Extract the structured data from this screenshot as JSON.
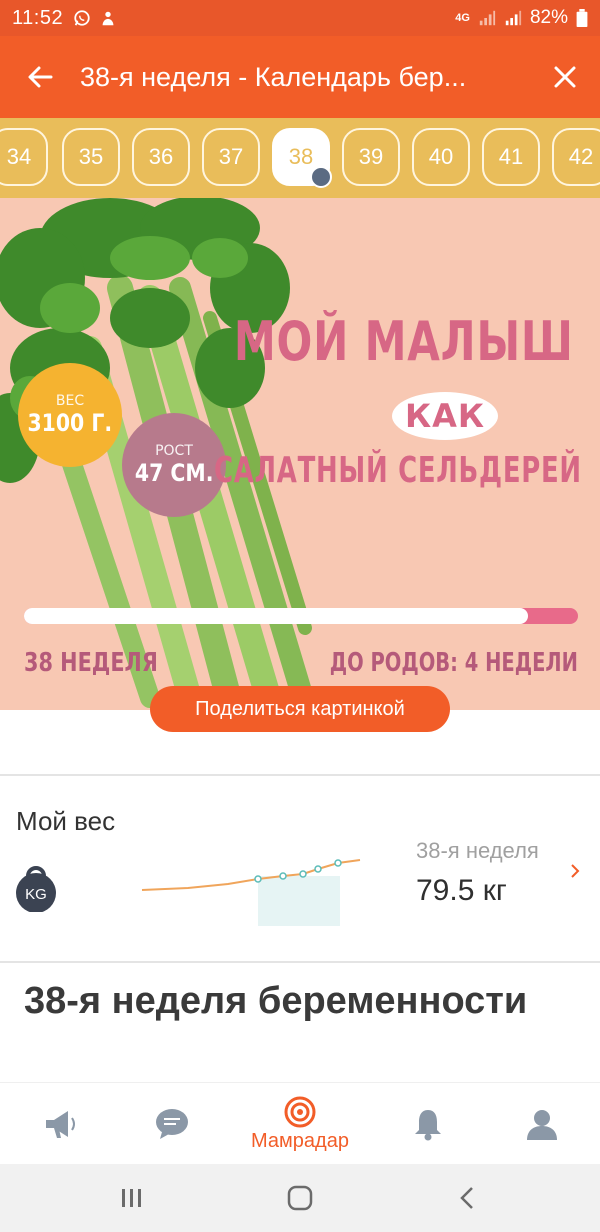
{
  "status_bar": {
    "time": "11:52",
    "network": "4G",
    "battery": "82%"
  },
  "app_bar": {
    "title": "38-я неделя - Календарь бер...",
    "back_icon": "arrow-left-icon",
    "close_icon": "close-icon"
  },
  "week_selector": {
    "weeks": [
      "34",
      "35",
      "36",
      "37",
      "38",
      "39",
      "40",
      "41",
      "42"
    ],
    "active": "38"
  },
  "banner": {
    "headline_line1": "МОЙ МАЛЫШ",
    "headline_line2": "КАК",
    "headline_line3": "САЛАТНЫЙ СЕЛЬДЕРЕЙ",
    "weight_label": "ВЕС",
    "weight_value": "3100 Г.",
    "height_label": "РОСТ",
    "height_value": "47 СМ.",
    "progress_fraction": 0.91,
    "week_label": "38 НЕДЕЛЯ",
    "remaining_label": "ДО РОДОВ: 4 НЕДЕЛИ",
    "colors": {
      "background": "#f8c8b3",
      "headline": "#d76785",
      "weight_badge": "#f5b330",
      "height_badge": "#b77a8c"
    }
  },
  "share_button": {
    "label": "Поделиться картинкой"
  },
  "weight": {
    "title": "Мой вес",
    "icon": "kg-weight-icon",
    "icon_text": "KG",
    "week": "38-я неделя",
    "value": "79.5 кг"
  },
  "article": {
    "heading": "38-я неделя беременности"
  },
  "tab_bar": {
    "items": [
      {
        "icon": "megaphone-icon",
        "label": ""
      },
      {
        "icon": "chat-icon",
        "label": ""
      },
      {
        "icon": "radar-icon",
        "label": "Мамрадар"
      },
      {
        "icon": "bell-icon",
        "label": ""
      },
      {
        "icon": "profile-icon",
        "label": ""
      }
    ],
    "active_color": "#f25d28"
  },
  "system_nav": {
    "items": [
      "recent-apps-icon",
      "home-icon",
      "back-icon"
    ]
  },
  "colors": {
    "accent": "#f25d28",
    "week_bar": "#e9bd5a"
  }
}
